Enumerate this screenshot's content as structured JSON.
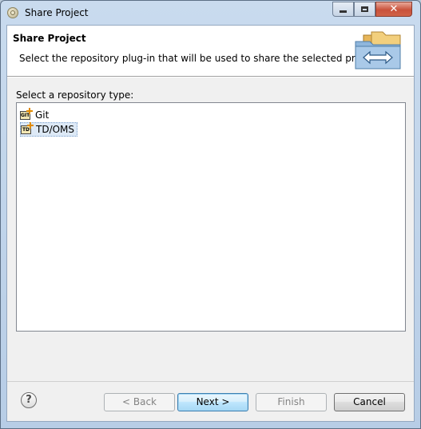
{
  "window": {
    "title": "Share Project"
  },
  "header": {
    "title": "Share Project",
    "description": "Select the repository plug-in that will be used to share the selected project.",
    "banner_icon": "folders-share-arrows-icon"
  },
  "list": {
    "label": "Select a repository type:",
    "items": [
      {
        "label": "Git",
        "icon_text": "GIT",
        "selected": false
      },
      {
        "label": "TD/OMS",
        "icon_text": "TD",
        "selected": true
      }
    ]
  },
  "buttons": {
    "help": "?",
    "back": "< Back",
    "next": "Next >",
    "finish": "Finish",
    "cancel": "Cancel"
  },
  "colors": {
    "selection": "#dde9f6",
    "default_button": "#bee6fd",
    "close_button": "#c9523b"
  }
}
